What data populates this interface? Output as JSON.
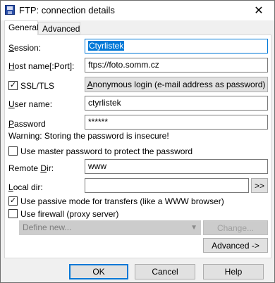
{
  "window": {
    "title": "FTP: connection details",
    "close_glyph": "✕",
    "icon": "app-floppy-icon"
  },
  "tabs": [
    {
      "label": "General",
      "active": true
    },
    {
      "label": "Advanced",
      "active": false
    }
  ],
  "session": {
    "label_u": "S",
    "label_rest": "ession:",
    "value": "Ctyrlistek"
  },
  "hostname": {
    "label_u": "H",
    "label_rest": "ost name[:Port]:",
    "value": "ftps://foto.somm.cz"
  },
  "ssl": {
    "label": "SSL/TLS",
    "checked": true
  },
  "anonymous_button": {
    "label_u": "A",
    "label_rest": "nonymous login (e-mail address as password)"
  },
  "user_name": {
    "label_u": "U",
    "label_rest": "ser name:",
    "value": "ctyrlistek"
  },
  "password": {
    "label_u": "P",
    "label_rest": "assword",
    "value": "******"
  },
  "warning": "Warning: Storing the password is insecure!",
  "master_password": {
    "label": "Use master password to protect the password",
    "checked": false
  },
  "remote_dir": {
    "label_a": "Remote ",
    "label_u": "D",
    "label_b": "ir:",
    "value": "www"
  },
  "local_dir": {
    "label_a": "L",
    "label_b": "ocal dir:",
    "value": "",
    "browse_label": ">>"
  },
  "passive_mode": {
    "label": "Use passive mode for transfers (like a WWW browser)",
    "checked": true
  },
  "firewall": {
    "label": "Use firewall (proxy server)",
    "checked": false
  },
  "proxy_select": {
    "value": "Define new...",
    "change_label": "Change..."
  },
  "advanced_button": {
    "label": "Advanced ->"
  },
  "buttons": {
    "ok": "OK",
    "cancel": "Cancel",
    "help": "Help"
  }
}
